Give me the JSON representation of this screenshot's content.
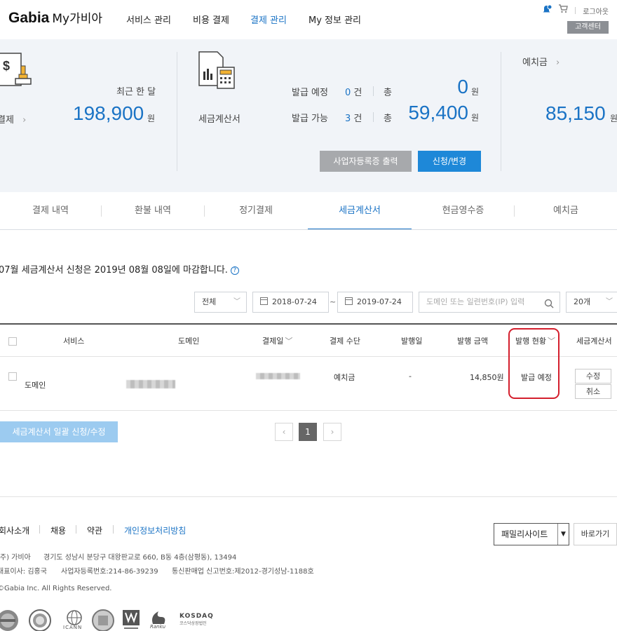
{
  "header": {
    "logo_brand": "Gabia",
    "logo_sub": "My가비아",
    "nav": [
      "서비스 관리",
      "비용 결제",
      "결제 관리",
      "My 정보 관리"
    ],
    "active_nav": "결제 관리",
    "logout": "로그아웃",
    "customer_center": "고객센터",
    "icons": [
      "bell-icon",
      "cart-icon"
    ]
  },
  "summary": {
    "payment": {
      "recent_label": "최근 한 달",
      "link_label": "결제",
      "amount": "198,900",
      "unit": "원"
    },
    "tax": {
      "title": "세금계산서",
      "row1": {
        "label": "발급 예정",
        "count": "0",
        "count_unit": "건",
        "total_label": "총",
        "amount": "0",
        "unit": "원"
      },
      "row2": {
        "label": "발급 가능",
        "count": "3",
        "count_unit": "건",
        "total_label": "총",
        "amount": "59,400",
        "unit": "원"
      },
      "btn_print": "사업자등록증 출력",
      "btn_apply": "신청/변경"
    },
    "deposit": {
      "label": "예치금",
      "amount": "85,150",
      "unit": "원"
    }
  },
  "tabs": [
    "결제 내역",
    "환불 내역",
    "정기결제",
    "세금계산서",
    "현금영수증",
    "예치금"
  ],
  "active_tab": "세금계산서",
  "notice": "07월 세금계산서 신청은 2019년 08월 08일에 마감합니다.",
  "filters": {
    "type": "전체",
    "date_from": "2018-07-24",
    "date_sep": "~",
    "date_to": "2019-07-24",
    "search_placeholder": "도메인 또는 일련번호(IP) 입력",
    "page_size": "20개"
  },
  "table": {
    "headers": {
      "service": "서비스",
      "domain": "도메인",
      "pay_date": "결제일",
      "method": "결제 수단",
      "issue_date": "발행일",
      "amount": "발행 금액",
      "status": "발행 현황",
      "invoice": "세금계산서"
    },
    "rows": [
      {
        "service": "도메인",
        "method": "예치금",
        "issue_date": "-",
        "amount": "14,850원",
        "status": "발급 예정",
        "btn_edit": "수정",
        "btn_cancel": "취소"
      }
    ]
  },
  "bulk_button": "세금계산서 일괄 신청/수정",
  "pagination": {
    "prev": "‹",
    "current": "1",
    "next": "›"
  },
  "footer": {
    "links": [
      "회사소개",
      "채용",
      "약관",
      "개인정보처리방침"
    ],
    "company": "(주) 가비아",
    "address": "경기도 성남시 분당구 대왕판교로 660, B동 4층(삼평동), 13494",
    "ceo": "대표이사: 김홍국",
    "biz_no": "사업자등록번호:214-86-39239",
    "mail_order": "통신판매업 신고번호:제2012-경기성남-1188호",
    "copyright": "©Gabia Inc. All Rights Reserved.",
    "family_site": "패밀리사이트",
    "go": "바로가기",
    "cert_icann": "ICANN",
    "cert_ranku": "Ranku",
    "cert_kosdaq": "KOSDAQ",
    "cert_kosdaq_sub": "코스닥상장법인"
  }
}
